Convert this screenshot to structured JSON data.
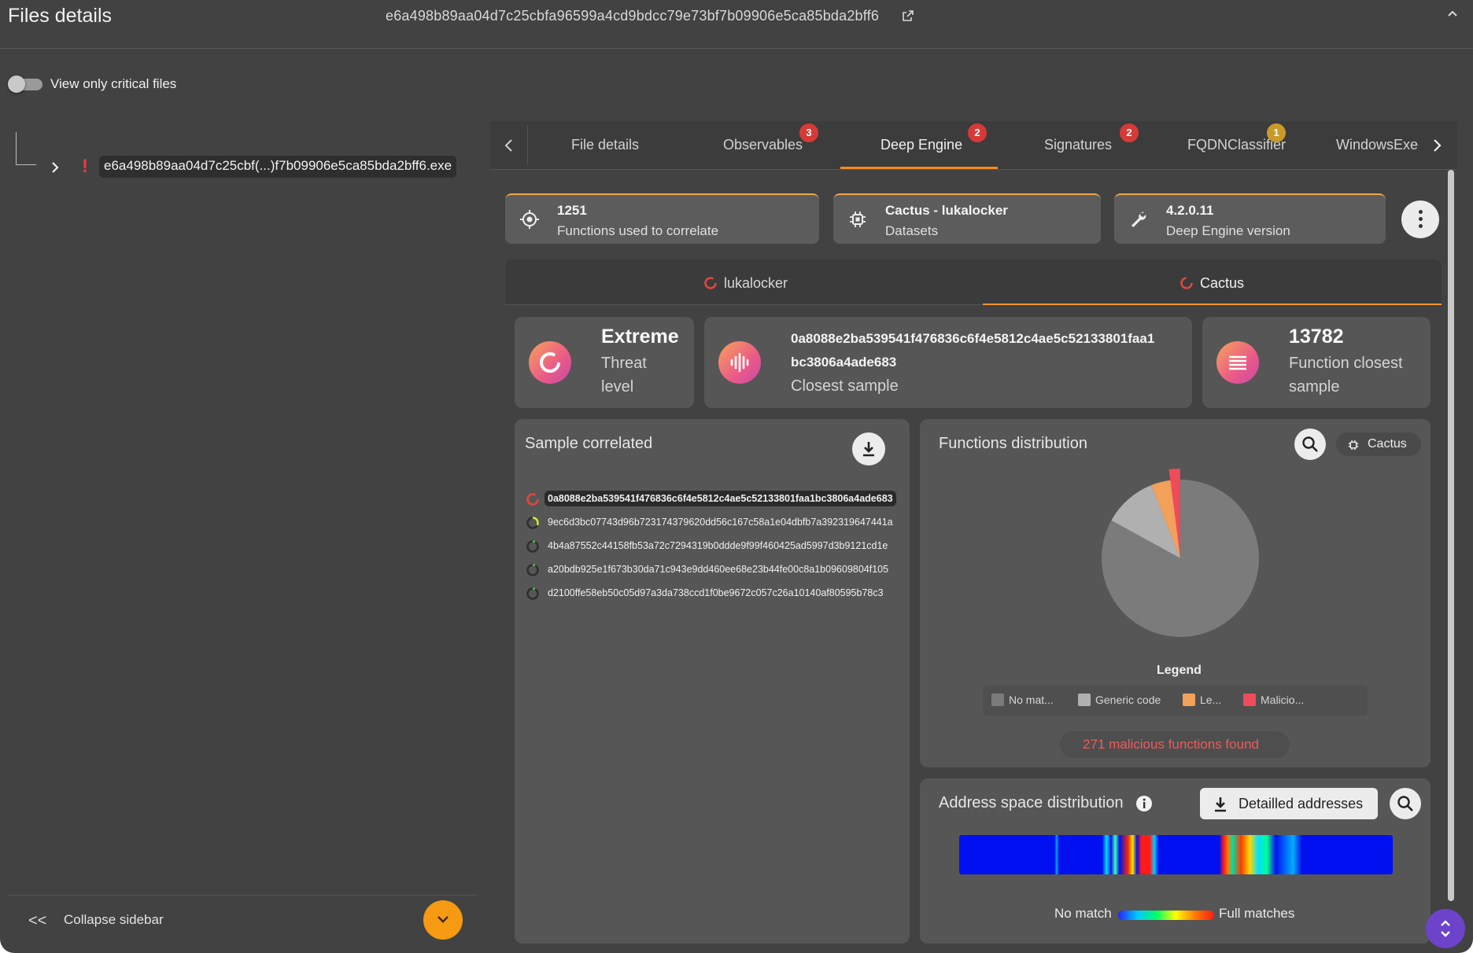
{
  "header": {
    "title": "Files details",
    "hash": "e6a498b89aa04d7c25cbfa96599a4cd9bdcc79e73bf7b09906e5ca85bda2bff6"
  },
  "toggle": {
    "label": "View only critical files",
    "on": false
  },
  "tree": {
    "file_name": "e6a498b89aa04d7c25cbf(...)f7b09906e5ca85bda2bff6.exe",
    "alert_icon": "error-icon"
  },
  "sidebar": {
    "collapse_label": "Collapse sidebar"
  },
  "tabs": [
    {
      "label": "File details",
      "badge": ""
    },
    {
      "label": "Observables",
      "badge": "3"
    },
    {
      "label": "Deep Engine",
      "badge": "2"
    },
    {
      "label": "Signatures",
      "badge": "2"
    },
    {
      "label": "FQDNClassifier",
      "badge": "1"
    },
    {
      "label": "WindowsExec",
      "badge": ""
    }
  ],
  "active_tab": "Deep Engine",
  "info_cards": [
    {
      "value": "1251",
      "label": "Functions used to correlate",
      "icon": "target-icon"
    },
    {
      "value": "Cactus - lukalocker",
      "label": "Datasets",
      "icon": "chip-icon"
    },
    {
      "value": "4.2.0.11",
      "label": "Deep Engine version",
      "icon": "wrench-icon"
    }
  ],
  "dataset_tabs": [
    {
      "label": "lukalocker"
    },
    {
      "label": "Cactus"
    }
  ],
  "active_dataset": "Cactus",
  "stats": {
    "threat_value": "Extreme",
    "threat_label_1": "Threat",
    "threat_label_2": "level",
    "closest_hash_1": "0a8088e2ba539541f476836c6f4e5812c4ae5c52133801faa1",
    "closest_hash_2": "bc3806a4ade683",
    "closest_label": "Closest sample",
    "functions_value": "13782",
    "functions_label_1": "Function closest",
    "functions_label_2": "sample"
  },
  "samples": {
    "title": "Sample correlated",
    "items": [
      "0a8088e2ba539541f476836c6f4e5812c4ae5c52133801faa1bc3806a4ade683",
      "9ec6d3bc07743d96b723174379620dd56c167c58a1e04dbfb7a392319647441a",
      "4b4a87552c44158fb53a72c7294319b0ddde9f99f460425ad5997d3b9121cd1e",
      "a20bdb925e1f673b30da71c943e9dd460ee68e23b44fe00c8a1b09609804f105",
      "d2100ffe58eb50c05d97a3da738ccd1f0be9672c057c26a10140af80595b78c3"
    ]
  },
  "functions": {
    "title": "Functions distribution",
    "chip_label": "Cactus",
    "legend_title": "Legend",
    "legend": [
      "No mat...",
      "Generic code",
      "Le...",
      "Malicio..."
    ],
    "malicious_text": "271 malicious functions found"
  },
  "chart_data": {
    "type": "pie",
    "categories": [
      "No mat...",
      "Generic code",
      "Le...",
      "Malicio..."
    ],
    "values": [
      83,
      11,
      4,
      2
    ],
    "colors": [
      "#7b7b7b",
      "#b0b0b0",
      "#f2a05a",
      "#ef4b5a"
    ],
    "legend": "bottom"
  },
  "address": {
    "title": "Address space distribution",
    "button_label": "Detailled addresses",
    "low_label": "No match",
    "high_label": "Full matches"
  },
  "colors": {
    "accent": "#f5891f",
    "badge": "#d63a37",
    "danger": "#ef5a5a"
  }
}
